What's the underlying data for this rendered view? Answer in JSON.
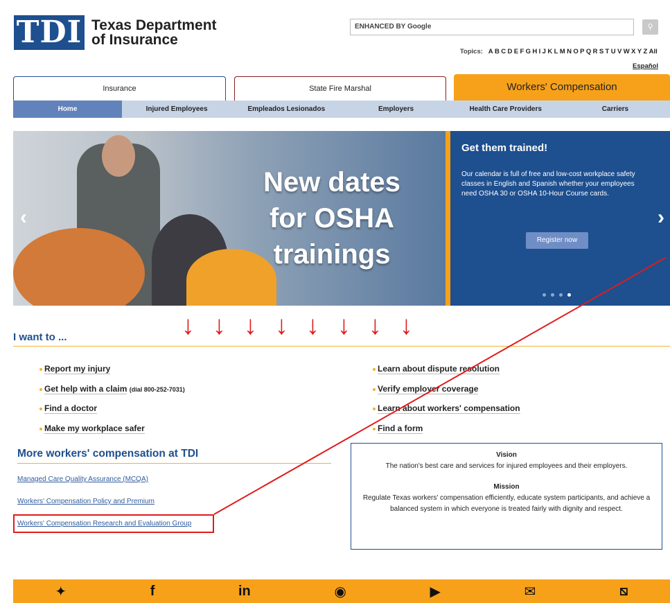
{
  "header": {
    "logo_mark": "TDI",
    "logo_text_line1": "Texas Department",
    "logo_text_line2": "of Insurance",
    "search_brand": "ENHANCED BY Google",
    "topics_label": "Topics:",
    "topics_letters": [
      "A",
      "B",
      "C",
      "D",
      "E",
      "F",
      "G",
      "H",
      "I",
      "J",
      "K",
      "L",
      "M",
      "N",
      "O",
      "P",
      "Q",
      "R",
      "S",
      "T",
      "U",
      "V",
      "W",
      "X",
      "Y",
      "Z",
      "All"
    ],
    "espanol": "Español"
  },
  "tabs": [
    {
      "label": "Insurance"
    },
    {
      "label": "State Fire Marshal"
    },
    {
      "label": "Workers' Compensation"
    }
  ],
  "subnav": [
    "Home",
    "Injured Employees",
    "Empleados Lesionados",
    "Employers",
    "Health Care Providers",
    "Carriers"
  ],
  "hero": {
    "title_line1": "New dates",
    "title_line2": "for OSHA",
    "title_line3": "trainings",
    "panel_title": "Get them trained!",
    "panel_text": "Our calendar is full of free and low-cost workplace safety classes in English and Spanish whether your employees need OSHA 30 or OSHA 10-Hour Course cards.",
    "button": "Register now",
    "prev_icon": "‹",
    "next_icon": "›"
  },
  "iwant": {
    "title": "I want to ...",
    "left": [
      {
        "text": "Report my injury",
        "note": ""
      },
      {
        "text": "Get help with a claim",
        "note": "(dial 800-252-7031)"
      },
      {
        "text": "Find a doctor",
        "note": ""
      },
      {
        "text": "Make my workplace safer",
        "note": ""
      }
    ],
    "right": [
      {
        "text": "Learn about dispute resolution"
      },
      {
        "text": "Verify employer coverage"
      },
      {
        "text": "Learn about workers' compensation"
      },
      {
        "text": "Find a form"
      }
    ]
  },
  "more": {
    "title": "More workers' compensation at TDI",
    "links": [
      "Managed Care Quality Assurance (MCQA)",
      "Workers' Compensation Policy and Premium",
      "Workers' Compensation Research and Evaluation Group"
    ]
  },
  "vm": {
    "vision_title": "Vision",
    "vision_text": "The nation's best care and services for injured employees and their employers.",
    "mission_title": "Mission",
    "mission_text": "Regulate Texas workers' compensation efficiently, educate system participants, and achieve a balanced system in which everyone is treated fairly with dignity and respect."
  },
  "footer_icons": [
    "twitter-icon",
    "facebook-icon",
    "linkedin-icon",
    "podcast-icon",
    "youtube-icon",
    "email-icon",
    "rss-icon"
  ],
  "colors": {
    "brand_blue": "#1e4f8f",
    "accent_orange": "#f7a11a",
    "annotation_red": "#e01b1b"
  }
}
